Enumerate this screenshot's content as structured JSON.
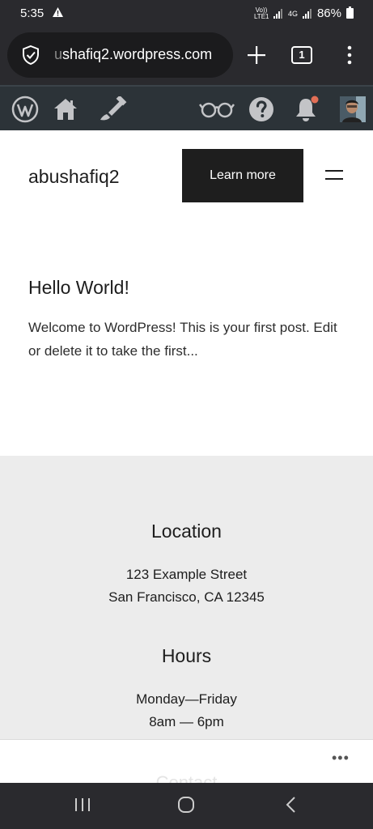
{
  "status": {
    "time": "5:35",
    "net1": "Vo)) LTE1",
    "net2": "4G",
    "battery": "86%"
  },
  "browser": {
    "url_faded": "u",
    "url_main": "shafiq2.wordpress.com",
    "tab_count": "1"
  },
  "wp_admin_bar": {
    "icons": [
      "wordpress-icon",
      "home-icon",
      "customize-brush-icon",
      "reader-glasses-icon",
      "help-icon",
      "notifications-bell-icon",
      "user-avatar"
    ],
    "notification_dot_color": "#e26f56"
  },
  "site": {
    "title": "abushafiq2",
    "cta_label": "Learn more"
  },
  "post": {
    "title": "Hello World!",
    "excerpt": "Welcome to WordPress! This is your first post. Edit or delete it to take the first..."
  },
  "footer": {
    "location_heading": "Location",
    "address_line1": "123 Example Street",
    "address_line2": "San Francisco, CA 12345",
    "hours_heading": "Hours",
    "hours_line1": "Monday—Friday",
    "hours_line2": "8am — 6pm",
    "next_heading_partial": "Contact"
  },
  "sheet": {
    "more_label": "•••"
  },
  "colors": {
    "dark_bar": "#2a2a2e",
    "wp_bar": "#2c3338",
    "cta_bg": "#1e1e1e",
    "footer_bg": "#ececec"
  }
}
